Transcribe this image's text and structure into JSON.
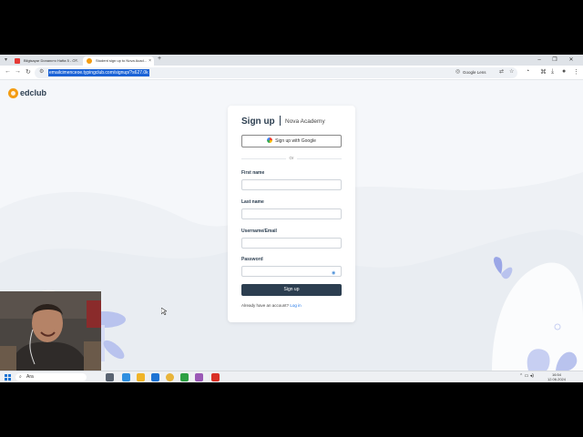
{
  "browser": {
    "tabs": [
      {
        "label": "Bilgisayar Donanımı Hafta 5 - Ö..."
      },
      {
        "label": "Student sign up to Nova Acad..."
      }
    ],
    "new_tab_label": "+",
    "url": "emailcimenceoe.typingclub.com/signup/?s627.0k",
    "lens_label": "Google Lens"
  },
  "page": {
    "logo_text": "edclub",
    "card": {
      "title": "Sign up",
      "subtitle": "Nova Academy",
      "google_button": "Sign up with Google",
      "divider_text": "Or",
      "fields": [
        {
          "label": "First name",
          "value": ""
        },
        {
          "label": "Last name",
          "value": ""
        },
        {
          "label": "Username/Email",
          "value": ""
        },
        {
          "label": "Password",
          "value": ""
        }
      ],
      "submit_label": "Sign up",
      "login_prompt": "Already have an account?",
      "login_link": "Log in"
    }
  },
  "taskbar": {
    "search_placeholder": "Ara",
    "time": "16:54",
    "date": "12.06.2024"
  },
  "colors": {
    "accent": "#2c3e50",
    "logo": "#f39c12",
    "link": "#1a73e8",
    "url_highlight": "#1a62d6"
  }
}
